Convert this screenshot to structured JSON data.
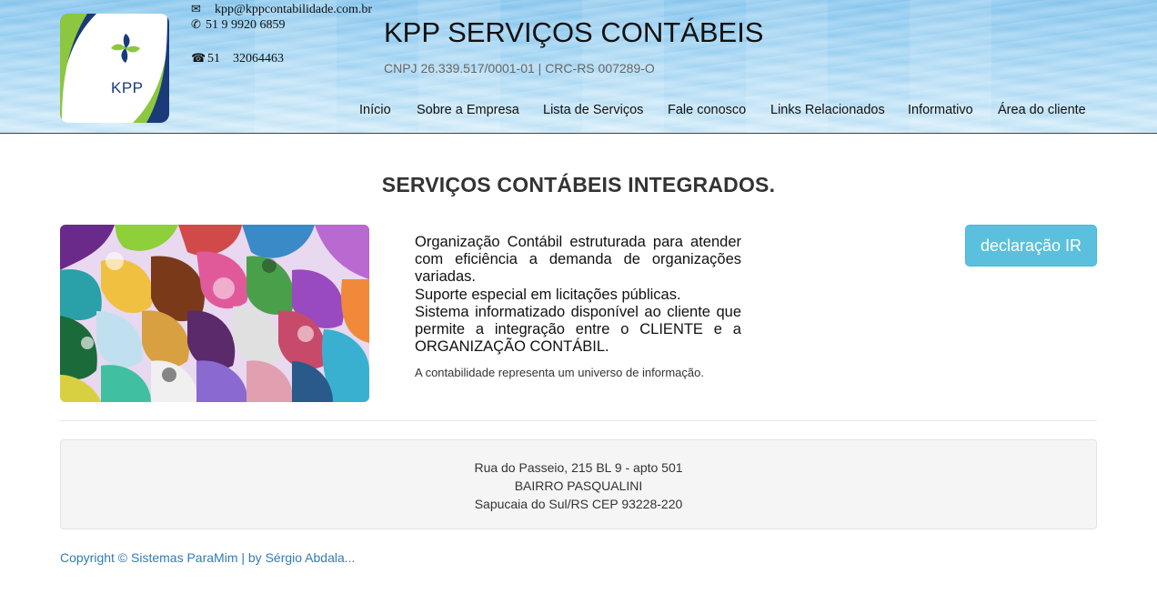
{
  "header": {
    "logo_text": "KPP",
    "email": "kpp@kppcontabilidade.com.br",
    "whatsapp": "51 9 9920 6859",
    "phone_ddd": "51",
    "phone_number": "32064463",
    "title": "KPP SERVIÇOS CONTÁBEIS",
    "subtitle": "CNPJ 26.339.517/0001-01 | CRC-RS 007289-O"
  },
  "nav": {
    "items": [
      {
        "label": "Início"
      },
      {
        "label": "Sobre a Empresa"
      },
      {
        "label": "Lista de Serviços"
      },
      {
        "label": "Fale conosco"
      },
      {
        "label": "Links Relacionados"
      },
      {
        "label": "Informativo"
      },
      {
        "label": "Área do cliente"
      }
    ]
  },
  "main": {
    "headline": "SERVIÇOS CONTÁBEIS INTEGRADOS.",
    "paragraphs": [
      "Organização Contábil estruturada para atender com eficiência a demanda de organizações variadas.",
      "Suporte especial em licitações públicas.",
      "Sistema informatizado disponível ao cliente que permite a integração entre o CLIENTE e a ORGANIZAÇÃO CONTÁBIL."
    ],
    "small_text": "A contabilidade representa um universo de informação.",
    "button_label": "declaração IR"
  },
  "footer": {
    "address_line1": "Rua do Passeio, 215 BL 9 - apto 501",
    "address_line2": "BAIRRO PASQUALINI",
    "address_line3": "Sapucaia do Sul/RS CEP 93228-220",
    "copyright": "Copyright © Sistemas ParaMim | by Sérgio Abdala..."
  },
  "colors": {
    "button": "#5bc0de",
    "link": "#337ab7",
    "logo_green": "#8dc63f",
    "logo_navy": "#1a3a7a"
  },
  "icons": [
    "envelope-icon",
    "whatsapp-icon",
    "phone-icon"
  ]
}
